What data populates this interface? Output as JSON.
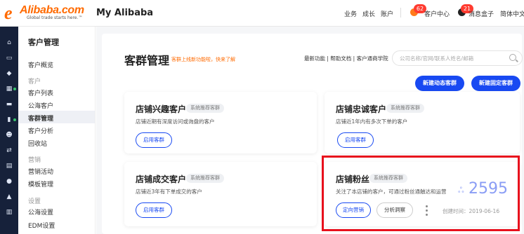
{
  "header": {
    "logo_text": "Alibaba.com",
    "logo_tagline": "Global trade starts here.™",
    "title": "My Alibaba",
    "nav": [
      "业务",
      "成长",
      "账户"
    ],
    "customer_center": "客户中心",
    "customer_center_badge": "62",
    "message_box": "消息盒子",
    "message_badge": "21",
    "language": "简体中文"
  },
  "rail_icons": [
    "home-icon",
    "calendar-icon",
    "shield-icon",
    "grid-icon",
    "chat-icon",
    "chart-icon",
    "users-icon",
    "arrows-icon",
    "document-icon",
    "globe-icon",
    "bell-icon",
    "bank-icon"
  ],
  "sidebar": {
    "title": "客户管理",
    "overview": "客户概览",
    "group_customer": "客户",
    "items_customer": [
      "客户列表",
      "公海客户",
      "客群管理",
      "客户分析",
      "回收站"
    ],
    "group_marketing": "营销",
    "items_marketing": [
      "营销活动",
      "模板管理"
    ],
    "group_settings": "设置",
    "items_settings": [
      "公海设置",
      "EDM设置"
    ]
  },
  "main": {
    "title": "客群管理",
    "subtitle": "客群上线新功能啦，快来了解",
    "links": "最新功能 | 帮助文档 | 客户通商学院",
    "search_placeholder": "公司名称/官网/联系人姓名/邮箱",
    "btn_dynamic": "新建动态客群",
    "btn_fixed": "新建固定客群",
    "tag": "系统推荐客群",
    "cards": [
      {
        "title": "店铺兴趣客户",
        "desc": "店铺近期有深度访问或询盘的客户",
        "button": "启用客群"
      },
      {
        "title": "店铺忠诚客户",
        "desc": "店铺近1年内有多次下单的客户",
        "button": "启用客群"
      },
      {
        "title": "店铺成交客户",
        "desc": "店铺近3年有下单成交的客户",
        "button": "启用客群"
      },
      {
        "title": "店铺粉丝",
        "desc": "关注了本店铺的客户，可通过粉丝通触达和运营",
        "button_primary": "定向营销",
        "button_secondary": "分析洞察",
        "count": "2595",
        "created": "创建时间：2019-06-16"
      }
    ]
  },
  "colors": {
    "brand": "#ff6a00",
    "primary": "#1849f2",
    "highlight": "#e8101d",
    "rail": "#16213a"
  }
}
